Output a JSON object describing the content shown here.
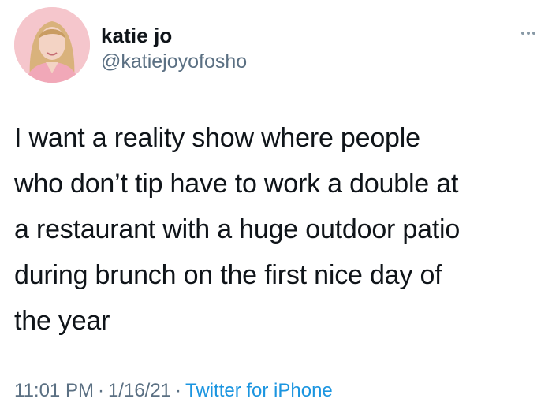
{
  "tweet": {
    "author": {
      "display_name": "katie jo",
      "handle": "@katiejoyofosho"
    },
    "more_icon": "more-horizontal-icon",
    "text_lines": [
      "I want a reality show where people",
      "who don’t tip have to work a double at",
      "a restaurant with a huge outdoor patio",
      "during brunch on the first nice day of",
      "the year"
    ],
    "time": "11:01 PM",
    "date": "1/16/21",
    "source": "Twitter for iPhone",
    "separator": "·"
  },
  "colors": {
    "background": "#ffffff",
    "text": "#0f1419",
    "secondary_text": "#5b7083",
    "link": "#1b95e0"
  }
}
